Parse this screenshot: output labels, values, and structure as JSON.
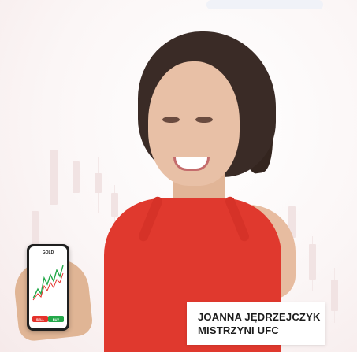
{
  "phone": {
    "title": "GOLD",
    "sell_label": "SELL",
    "buy_label": "BUY"
  },
  "caption": {
    "line1": "JOANNA JĘDRZEJCZYK",
    "line2": "MISTRZYNI UFC"
  },
  "colors": {
    "accent_red": "#e0392e",
    "buy_green": "#24a84a",
    "sell_red": "#e4322b"
  }
}
